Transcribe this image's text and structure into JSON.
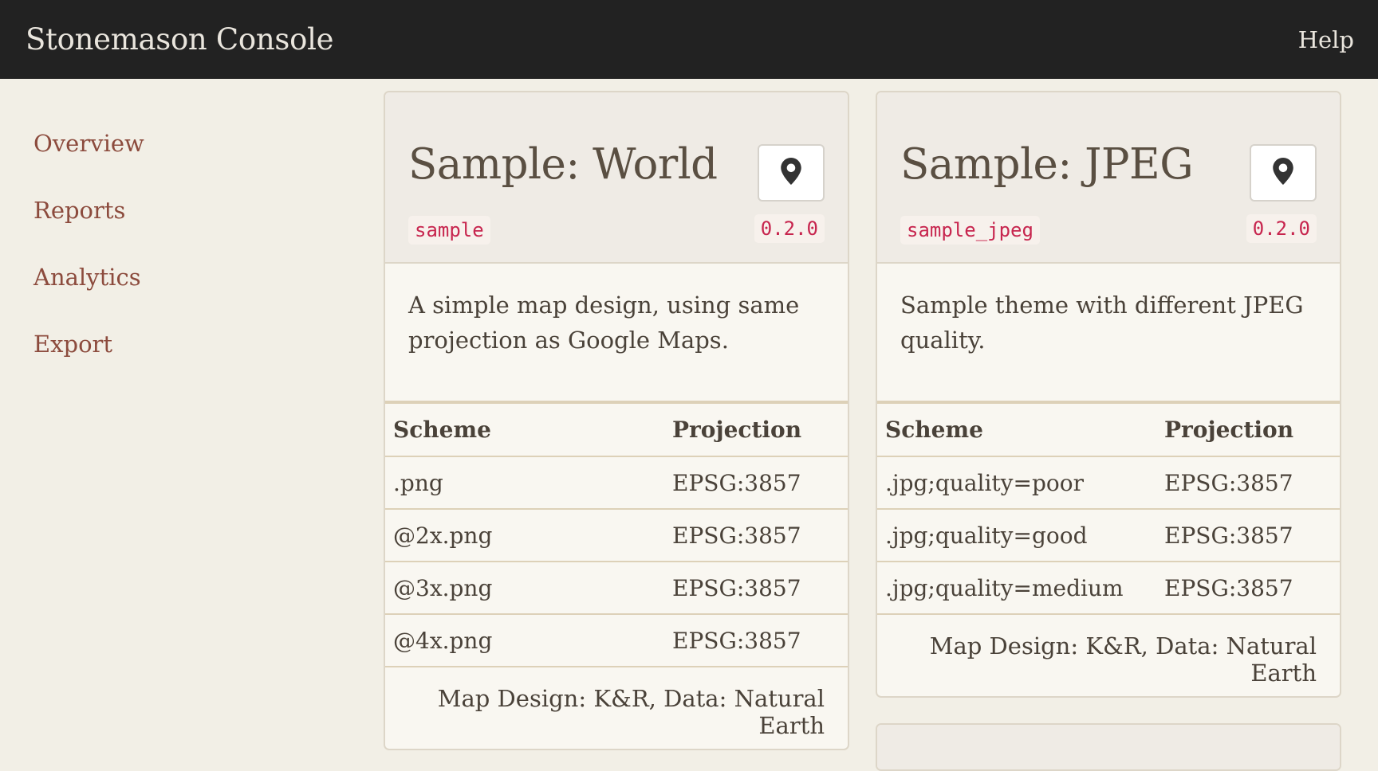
{
  "app": {
    "title": "Stonemason Console",
    "help_label": "Help"
  },
  "sidebar": {
    "items": [
      {
        "label": "Overview"
      },
      {
        "label": "Reports"
      },
      {
        "label": "Analytics"
      },
      {
        "label": "Export"
      }
    ]
  },
  "themes": [
    {
      "title": "Sample: World",
      "id": "sample",
      "version": "0.2.0",
      "description": "A simple map design, using same projection as Google Maps.",
      "table_headers": {
        "scheme": "Scheme",
        "projection": "Projection"
      },
      "rows": [
        {
          "scheme": ".png",
          "projection": "EPSG:3857"
        },
        {
          "scheme": "@2x.png",
          "projection": "EPSG:3857"
        },
        {
          "scheme": "@3x.png",
          "projection": "EPSG:3857"
        },
        {
          "scheme": "@4x.png",
          "projection": "EPSG:3857"
        }
      ],
      "footer": "Map Design: K&R, Data: Natural Earth"
    },
    {
      "title": "Sample: JPEG",
      "id": "sample_jpeg",
      "version": "0.2.0",
      "description": "Sample theme with different JPEG quality.",
      "table_headers": {
        "scheme": "Scheme",
        "projection": "Projection"
      },
      "rows": [
        {
          "scheme": ".jpg;quality=poor",
          "projection": "EPSG:3857"
        },
        {
          "scheme": ".jpg;quality=good",
          "projection": "EPSG:3857"
        },
        {
          "scheme": ".jpg;quality=medium",
          "projection": "EPSG:3857"
        }
      ],
      "footer": "Map Design: K&R, Data: Natural Earth"
    }
  ],
  "icons": {
    "map_button": "map-marker-icon"
  },
  "colors": {
    "navbar": "#222222",
    "link": "#8c4b3d",
    "code": "#c7254e",
    "background": "#f2efe6"
  }
}
